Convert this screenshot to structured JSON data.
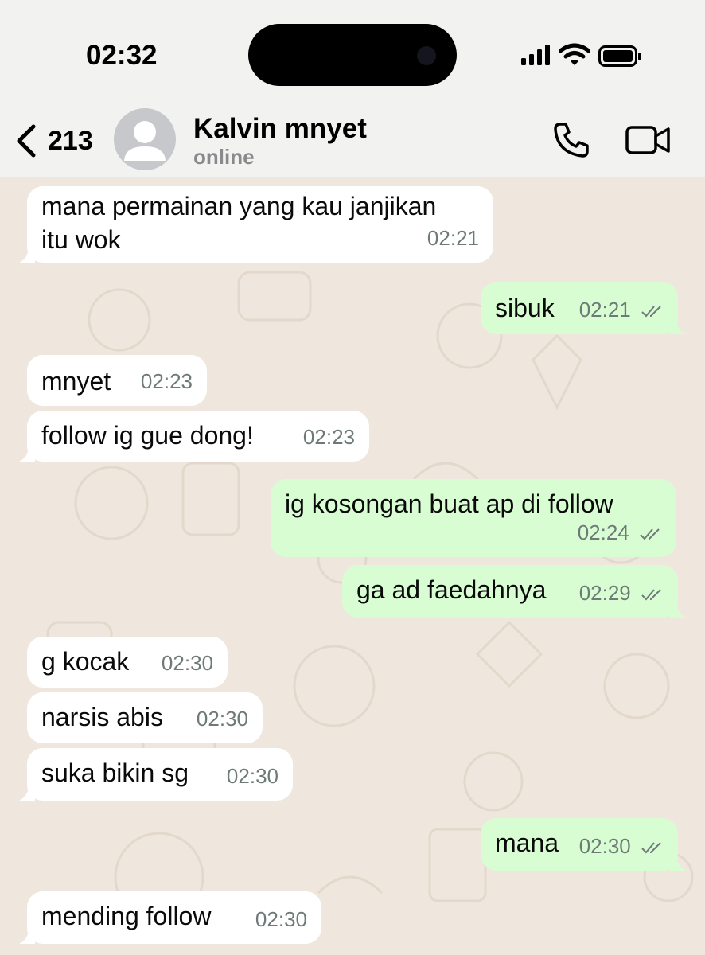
{
  "status_bar": {
    "time": "02:32"
  },
  "header": {
    "back_count": "213",
    "contact_name": "Kalvin mnyet",
    "presence": "online"
  },
  "icons": {
    "back": "chevron-left-icon",
    "avatar": "person-icon",
    "call": "phone-icon",
    "video": "video-camera-icon",
    "read_receipt": "double-check-icon"
  },
  "colors": {
    "incoming_bubble": "#ffffff",
    "outgoing_bubble": "#d9fdd3",
    "chat_background": "#efe7dd",
    "header_background": "#f2f2f1",
    "read_tick": "#6e7a78"
  },
  "messages": [
    {
      "direction": "in",
      "text_lines": [
        "mana permainan yang kau janjikan",
        "itu wok"
      ],
      "time": "02:21"
    },
    {
      "direction": "out",
      "text": "sibuk",
      "time": "02:21",
      "read": true
    },
    {
      "direction": "in",
      "text": "mnyet",
      "time": "02:23"
    },
    {
      "direction": "in",
      "text": "follow ig gue dong!",
      "time": "02:23"
    },
    {
      "direction": "out",
      "text": "ig kosongan buat ap di follow",
      "time": "02:24",
      "read": true
    },
    {
      "direction": "out",
      "text": "ga ad faedahnya",
      "time": "02:29",
      "read": true
    },
    {
      "direction": "in",
      "text": "g kocak",
      "time": "02:30"
    },
    {
      "direction": "in",
      "text": "narsis abis",
      "time": "02:30"
    },
    {
      "direction": "in",
      "text": "suka bikin sg",
      "time": "02:30"
    },
    {
      "direction": "out",
      "text": "mana",
      "time": "02:30",
      "read": true
    },
    {
      "direction": "in",
      "text": "mending follow",
      "time": "02:30"
    }
  ]
}
